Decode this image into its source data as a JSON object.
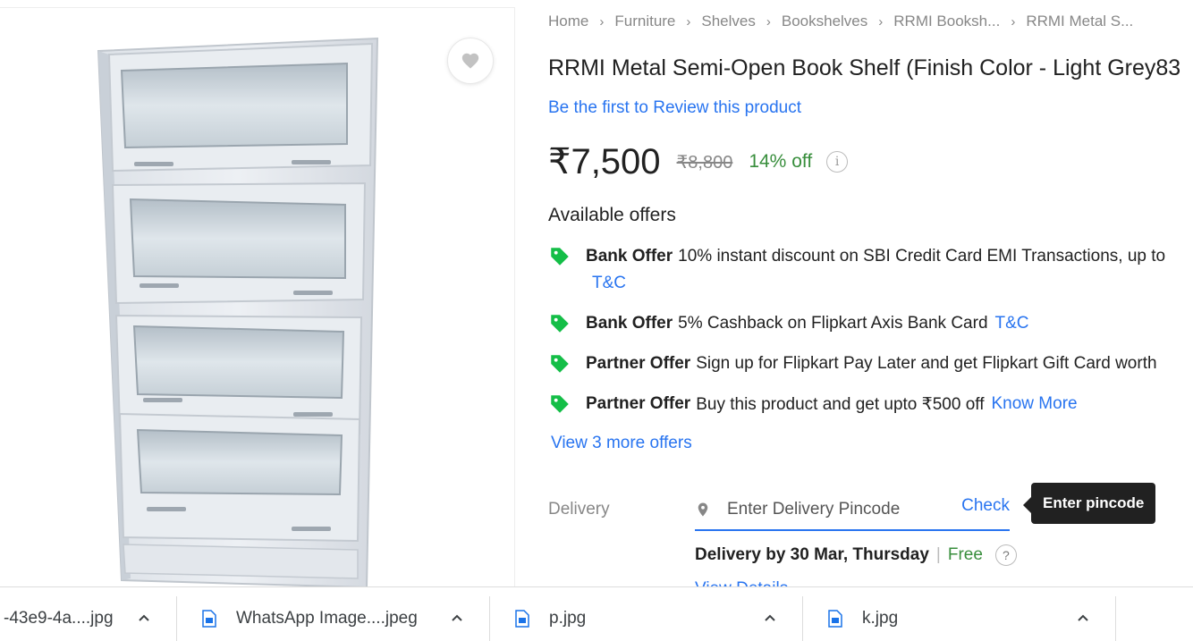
{
  "breadcrumb": [
    "Home",
    "Furniture",
    "Shelves",
    "Bookshelves",
    "RRMI Booksh...",
    "RRMI Metal S..."
  ],
  "product": {
    "title": "RRMI Metal Semi-Open Book Shelf  (Finish Color - Light Grey83",
    "review_link": "Be the first to Review this product",
    "price": "₹7,500",
    "mrp": "₹8,800",
    "discount": "14% off"
  },
  "offers": {
    "heading": "Available offers",
    "items": [
      {
        "kind": "Bank Offer",
        "text": "10% instant discount on SBI Credit Card EMI Transactions, up to",
        "link": "T&C"
      },
      {
        "kind": "Bank Offer",
        "text": "5% Cashback on Flipkart Axis Bank Card",
        "link": "T&C"
      },
      {
        "kind": "Partner Offer",
        "text": "Sign up for Flipkart Pay Later and get Flipkart Gift Card worth",
        "link": ""
      },
      {
        "kind": "Partner Offer",
        "text": "Buy this product and get upto ₹500 off",
        "link": "Know More"
      }
    ],
    "more": "View 3 more offers"
  },
  "delivery": {
    "label": "Delivery",
    "pincode_placeholder": "Enter Delivery Pincode",
    "check": "Check",
    "tooltip": "Enter pincode",
    "date": "Delivery by 30 Mar, Thursday",
    "separator": "|",
    "free": "Free",
    "help": "?",
    "view_details": "View Details"
  },
  "downloads": [
    {
      "name": "-43e9-4a....jpg"
    },
    {
      "name": "WhatsApp Image....jpeg"
    },
    {
      "name": "p.jpg"
    },
    {
      "name": "k.jpg"
    }
  ],
  "icons": {
    "wishlist": "heart-icon",
    "offer": "tag-icon",
    "pincode": "location-pin-icon",
    "info": "info-icon",
    "download": "file-icon",
    "expand": "chevron-up-icon"
  },
  "colors": {
    "link": "#2874f0",
    "green": "#388e3c",
    "text": "#212121",
    "muted": "#878787"
  }
}
